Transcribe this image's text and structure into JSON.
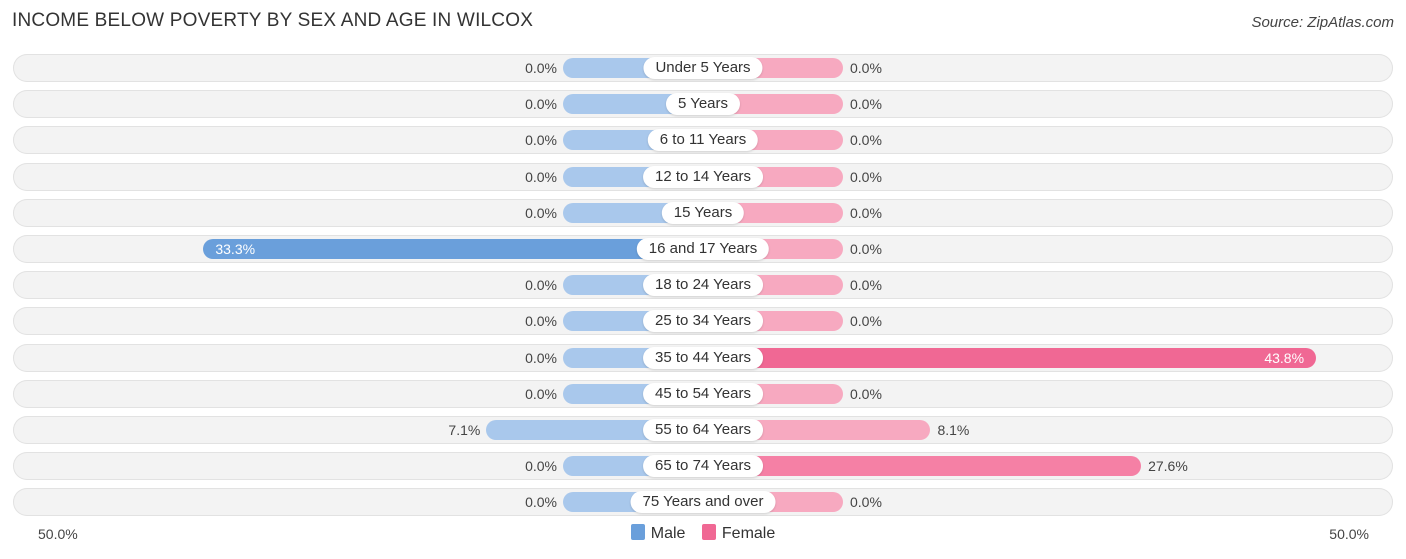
{
  "chart_data": {
    "type": "bar",
    "orientation": "horizontal-diverging",
    "title": "INCOME BELOW POVERTY BY SEX AND AGE IN WILCOX",
    "source": "Source: ZipAtlas.com",
    "categories": [
      "Under 5 Years",
      "5 Years",
      "6 to 11 Years",
      "12 to 14 Years",
      "15 Years",
      "16 and 17 Years",
      "18 to 24 Years",
      "25 to 34 Years",
      "35 to 44 Years",
      "45 to 54 Years",
      "55 to 64 Years",
      "65 to 74 Years",
      "75 Years and over"
    ],
    "series": [
      {
        "name": "Male",
        "color": "#6a9fdb",
        "color_light": "#a9c8ec",
        "values": [
          0.0,
          0.0,
          0.0,
          0.0,
          0.0,
          33.3,
          0.0,
          0.0,
          0.0,
          0.0,
          7.1,
          0.0,
          0.0
        ],
        "labels": [
          "0.0%",
          "0.0%",
          "0.0%",
          "0.0%",
          "0.0%",
          "33.3%",
          "0.0%",
          "0.0%",
          "0.0%",
          "0.0%",
          "7.1%",
          "0.0%",
          "0.0%"
        ]
      },
      {
        "name": "Female",
        "color": "#f06894",
        "color_light": "#f7a9c0",
        "values": [
          0.0,
          0.0,
          0.0,
          0.0,
          0.0,
          0.0,
          0.0,
          0.0,
          43.8,
          0.0,
          8.1,
          27.6,
          0.0
        ],
        "labels": [
          "0.0%",
          "0.0%",
          "0.0%",
          "0.0%",
          "0.0%",
          "0.0%",
          "0.0%",
          "0.0%",
          "43.8%",
          "0.0%",
          "8.1%",
          "27.6%",
          "0.0%"
        ]
      }
    ],
    "axis": {
      "left_label": "50.0%",
      "right_label": "50.0%",
      "xlim": [
        -50,
        50
      ]
    },
    "legend": {
      "position": "bottom-center",
      "items": [
        "Male",
        "Female"
      ]
    }
  }
}
